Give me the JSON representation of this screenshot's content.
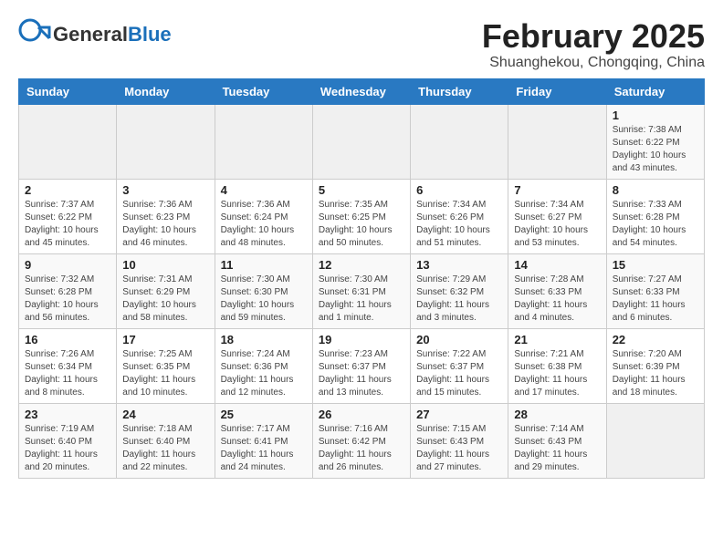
{
  "header": {
    "logo_line1": "General",
    "logo_line2": "Blue",
    "title": "February 2025",
    "subtitle": "Shuanghekou, Chongqing, China"
  },
  "weekdays": [
    "Sunday",
    "Monday",
    "Tuesday",
    "Wednesday",
    "Thursday",
    "Friday",
    "Saturday"
  ],
  "weeks": [
    [
      {
        "day": "",
        "info": ""
      },
      {
        "day": "",
        "info": ""
      },
      {
        "day": "",
        "info": ""
      },
      {
        "day": "",
        "info": ""
      },
      {
        "day": "",
        "info": ""
      },
      {
        "day": "",
        "info": ""
      },
      {
        "day": "1",
        "info": "Sunrise: 7:38 AM\nSunset: 6:22 PM\nDaylight: 10 hours and 43 minutes."
      }
    ],
    [
      {
        "day": "2",
        "info": "Sunrise: 7:37 AM\nSunset: 6:22 PM\nDaylight: 10 hours and 45 minutes."
      },
      {
        "day": "3",
        "info": "Sunrise: 7:36 AM\nSunset: 6:23 PM\nDaylight: 10 hours and 46 minutes."
      },
      {
        "day": "4",
        "info": "Sunrise: 7:36 AM\nSunset: 6:24 PM\nDaylight: 10 hours and 48 minutes."
      },
      {
        "day": "5",
        "info": "Sunrise: 7:35 AM\nSunset: 6:25 PM\nDaylight: 10 hours and 50 minutes."
      },
      {
        "day": "6",
        "info": "Sunrise: 7:34 AM\nSunset: 6:26 PM\nDaylight: 10 hours and 51 minutes."
      },
      {
        "day": "7",
        "info": "Sunrise: 7:34 AM\nSunset: 6:27 PM\nDaylight: 10 hours and 53 minutes."
      },
      {
        "day": "8",
        "info": "Sunrise: 7:33 AM\nSunset: 6:28 PM\nDaylight: 10 hours and 54 minutes."
      }
    ],
    [
      {
        "day": "9",
        "info": "Sunrise: 7:32 AM\nSunset: 6:28 PM\nDaylight: 10 hours and 56 minutes."
      },
      {
        "day": "10",
        "info": "Sunrise: 7:31 AM\nSunset: 6:29 PM\nDaylight: 10 hours and 58 minutes."
      },
      {
        "day": "11",
        "info": "Sunrise: 7:30 AM\nSunset: 6:30 PM\nDaylight: 10 hours and 59 minutes."
      },
      {
        "day": "12",
        "info": "Sunrise: 7:30 AM\nSunset: 6:31 PM\nDaylight: 11 hours and 1 minute."
      },
      {
        "day": "13",
        "info": "Sunrise: 7:29 AM\nSunset: 6:32 PM\nDaylight: 11 hours and 3 minutes."
      },
      {
        "day": "14",
        "info": "Sunrise: 7:28 AM\nSunset: 6:33 PM\nDaylight: 11 hours and 4 minutes."
      },
      {
        "day": "15",
        "info": "Sunrise: 7:27 AM\nSunset: 6:33 PM\nDaylight: 11 hours and 6 minutes."
      }
    ],
    [
      {
        "day": "16",
        "info": "Sunrise: 7:26 AM\nSunset: 6:34 PM\nDaylight: 11 hours and 8 minutes."
      },
      {
        "day": "17",
        "info": "Sunrise: 7:25 AM\nSunset: 6:35 PM\nDaylight: 11 hours and 10 minutes."
      },
      {
        "day": "18",
        "info": "Sunrise: 7:24 AM\nSunset: 6:36 PM\nDaylight: 11 hours and 12 minutes."
      },
      {
        "day": "19",
        "info": "Sunrise: 7:23 AM\nSunset: 6:37 PM\nDaylight: 11 hours and 13 minutes."
      },
      {
        "day": "20",
        "info": "Sunrise: 7:22 AM\nSunset: 6:37 PM\nDaylight: 11 hours and 15 minutes."
      },
      {
        "day": "21",
        "info": "Sunrise: 7:21 AM\nSunset: 6:38 PM\nDaylight: 11 hours and 17 minutes."
      },
      {
        "day": "22",
        "info": "Sunrise: 7:20 AM\nSunset: 6:39 PM\nDaylight: 11 hours and 18 minutes."
      }
    ],
    [
      {
        "day": "23",
        "info": "Sunrise: 7:19 AM\nSunset: 6:40 PM\nDaylight: 11 hours and 20 minutes."
      },
      {
        "day": "24",
        "info": "Sunrise: 7:18 AM\nSunset: 6:40 PM\nDaylight: 11 hours and 22 minutes."
      },
      {
        "day": "25",
        "info": "Sunrise: 7:17 AM\nSunset: 6:41 PM\nDaylight: 11 hours and 24 minutes."
      },
      {
        "day": "26",
        "info": "Sunrise: 7:16 AM\nSunset: 6:42 PM\nDaylight: 11 hours and 26 minutes."
      },
      {
        "day": "27",
        "info": "Sunrise: 7:15 AM\nSunset: 6:43 PM\nDaylight: 11 hours and 27 minutes."
      },
      {
        "day": "28",
        "info": "Sunrise: 7:14 AM\nSunset: 6:43 PM\nDaylight: 11 hours and 29 minutes."
      },
      {
        "day": "",
        "info": ""
      }
    ]
  ]
}
